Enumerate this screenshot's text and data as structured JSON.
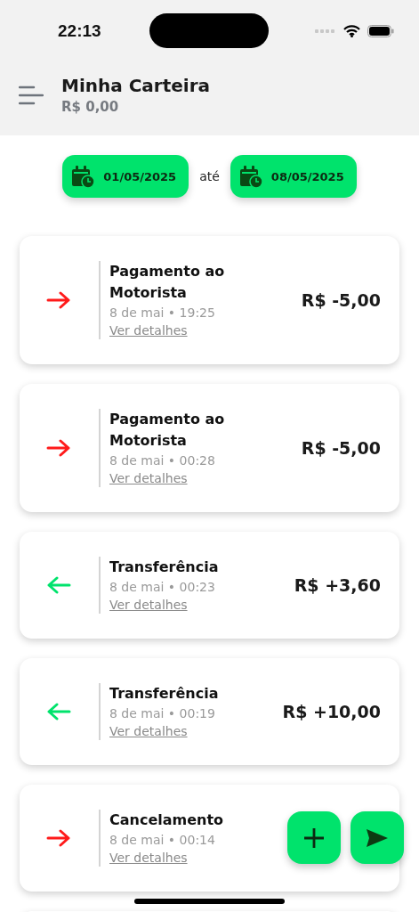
{
  "status_bar": {
    "time": "22:13"
  },
  "header": {
    "title": "Minha Carteira",
    "balance": "R$ 0,00"
  },
  "date_range": {
    "start": "01/05/2025",
    "separator": "até",
    "end": "08/05/2025"
  },
  "transactions": [
    {
      "kind": "out",
      "title": "Pagamento ao Motorista",
      "datetime": "8 de mai • 19:25",
      "link": "Ver detalhes",
      "amount": "R$ -5,00"
    },
    {
      "kind": "out",
      "title": "Pagamento ao Motorista",
      "datetime": "8 de mai • 00:28",
      "link": "Ver detalhes",
      "amount": "R$ -5,00"
    },
    {
      "kind": "in",
      "title": "Transferência",
      "datetime": "8 de mai • 00:23",
      "link": "Ver detalhes",
      "amount": "R$ +3,60"
    },
    {
      "kind": "in",
      "title": "Transferência",
      "datetime": "8 de mai • 00:19",
      "link": "Ver detalhes",
      "amount": "R$ +10,00"
    },
    {
      "kind": "out",
      "title": "Cancelamento",
      "datetime": "8 de mai • 00:14",
      "link": "Ver detalhes"
    },
    {
      "kind": "partial"
    }
  ]
}
